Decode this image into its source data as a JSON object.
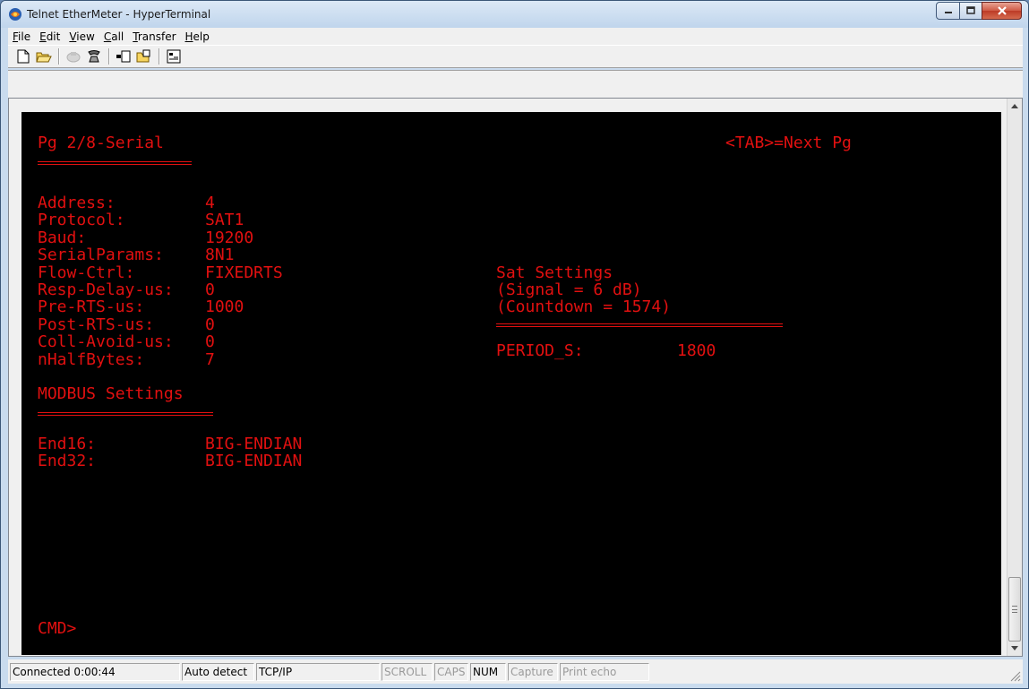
{
  "window": {
    "title": "Telnet EtherMeter - HyperTerminal"
  },
  "menubar": {
    "items": [
      {
        "accel": "F",
        "rest": "ile"
      },
      {
        "accel": "E",
        "rest": "dit"
      },
      {
        "accel": "V",
        "rest": "iew"
      },
      {
        "accel": "C",
        "rest": "all"
      },
      {
        "accel": "T",
        "rest": "ransfer"
      },
      {
        "accel": "H",
        "rest": "elp"
      }
    ]
  },
  "toolbar": {
    "icons": [
      "new-icon",
      "open-icon",
      "disconnect-icon",
      "dial-icon",
      "send-icon",
      "receive-icon",
      "properties-icon"
    ]
  },
  "terminal": {
    "page_title": "Pg 2/8-Serial",
    "tab_hint": "<TAB>=Next Pg",
    "serial": [
      {
        "label": "Address:",
        "value": "4"
      },
      {
        "label": "Protocol:",
        "value": "SAT1"
      },
      {
        "label": "Baud:",
        "value": "19200"
      },
      {
        "label": "SerialParams:",
        "value": "8N1"
      },
      {
        "label": "Flow-Ctrl:",
        "value": "FIXEDRTS"
      },
      {
        "label": "Resp-Delay-us:",
        "value": "0"
      },
      {
        "label": "Pre-RTS-us:",
        "value": "1000"
      },
      {
        "label": "Post-RTS-us:",
        "value": "0"
      },
      {
        "label": "Coll-Avoid-us:",
        "value": "0"
      },
      {
        "label": "nHalfBytes:",
        "value": "7"
      }
    ],
    "modbus_heading": "MODBUS Settings",
    "modbus": [
      {
        "label": "End16:",
        "value": "BIG-ENDIAN"
      },
      {
        "label": "End32:",
        "value": "BIG-ENDIAN"
      }
    ],
    "sat_heading": "Sat Settings",
    "sat_signal": "(Signal = 6 dB)",
    "sat_countdown": "(Countdown = 1574)",
    "period_label": "PERIOD_S:",
    "period_value": "1800",
    "prompt": "CMD>"
  },
  "statusbar": {
    "connected": "Connected 0:00:44",
    "detect": "Auto detect",
    "protocol": "TCP/IP",
    "scroll": "SCROLL",
    "caps": "CAPS",
    "num": "NUM",
    "capture": "Capture",
    "print_echo": "Print echo"
  },
  "colors": {
    "terminal_bg": "#000000",
    "terminal_fg": "#e21010"
  }
}
